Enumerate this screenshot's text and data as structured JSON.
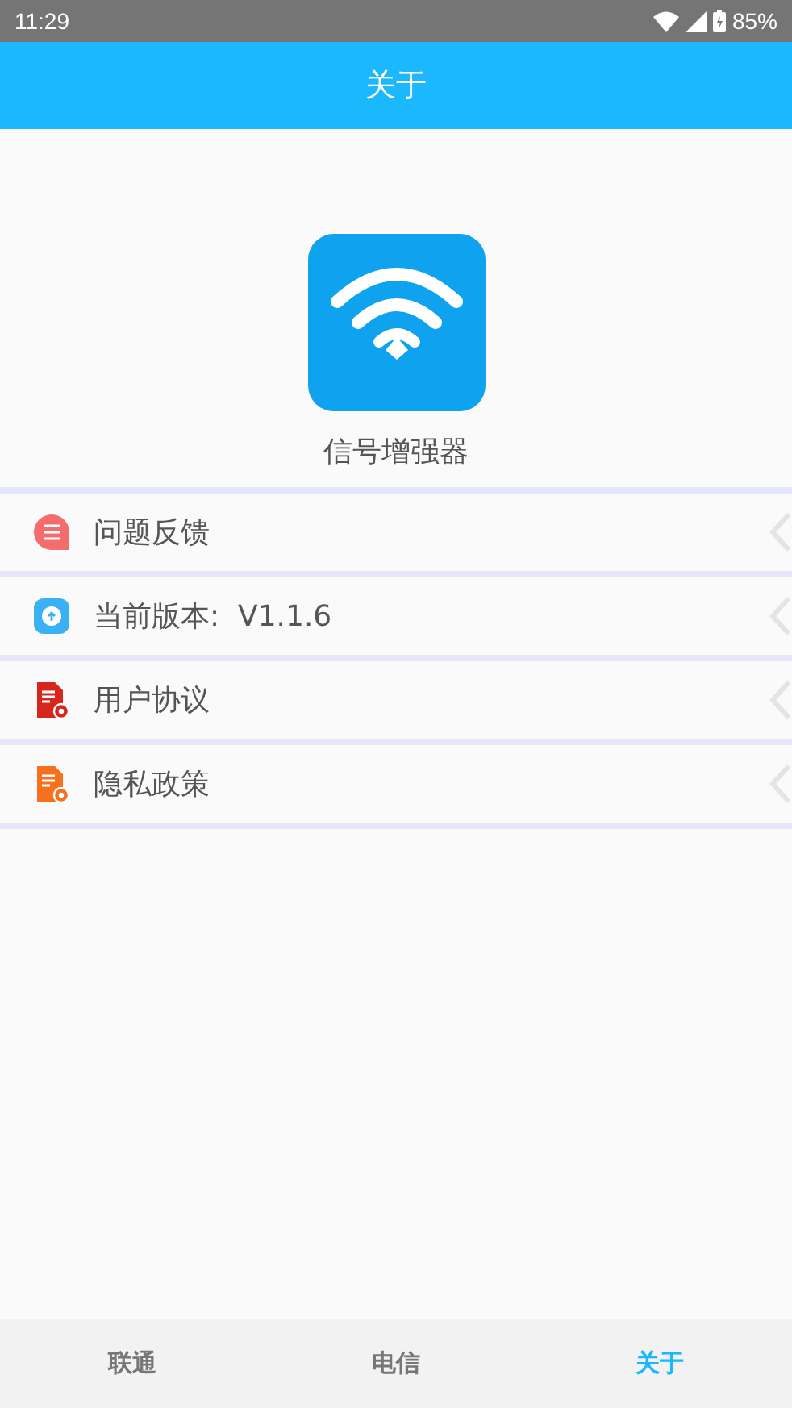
{
  "status_bar": {
    "time": "11:29",
    "battery": "85%"
  },
  "header": {
    "title": "关于"
  },
  "app": {
    "name": "信号增强器"
  },
  "menu": [
    {
      "kind": "chat",
      "label": "问题反馈"
    },
    {
      "kind": "info",
      "label": "当前版本:  V1.1.6"
    },
    {
      "kind": "agreement",
      "label": "用户协议"
    },
    {
      "kind": "privacy",
      "label": "隐私政策"
    }
  ],
  "tabs": [
    {
      "label": "联通",
      "selected": false
    },
    {
      "label": "电信",
      "selected": false
    },
    {
      "label": "关于",
      "selected": true
    }
  ]
}
